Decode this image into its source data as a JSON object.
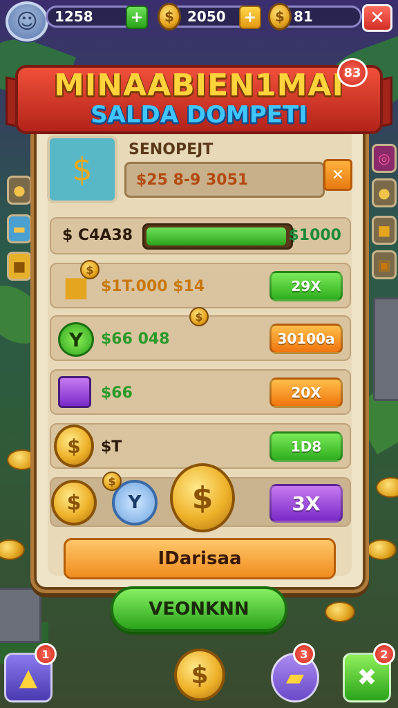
{
  "topbar": {
    "gems_value": "1258",
    "coins_value": "2050",
    "other_value": "81",
    "plus_green": "+",
    "plus_yellow": "+",
    "close": "✕"
  },
  "banner": {
    "title": "MINAABIEN1MAI",
    "subtitle": "SALDA DOMPETI",
    "badge": "83"
  },
  "wallet": {
    "label": "SENOPEJT",
    "value": "$25 8-9 3051",
    "close_label": "✕"
  },
  "progress": {
    "left_label": "$ C4A38",
    "right_label": "$1000",
    "fill_fraction": 0.98
  },
  "items": [
    {
      "text": "$1T.000 $14",
      "text_color": "#c8780a",
      "button_label": "29X",
      "button_style": "green"
    },
    {
      "text": "$66 048",
      "text_color": "#2a9a2a",
      "icon_text": "Y",
      "button_label": "30100a",
      "button_style": "orange"
    },
    {
      "text": "$66",
      "text_color": "#2a9a2a",
      "button_label": "20X",
      "button_style": "orange"
    },
    {
      "text": "$T",
      "text_color": "#2b1a0a",
      "button_label": "1D8",
      "button_style": "green"
    },
    {
      "button_label": "3X",
      "button_style": "purple"
    }
  ],
  "coin_symbol": "$",
  "token_symbol": "Y",
  "action_label": "IDarisaa",
  "confirm_label": "VEONKNN",
  "bottom": {
    "left_badge": "1",
    "mid_badge": "3",
    "right_badge": "2"
  },
  "colors": {
    "panel": "#efe3c8",
    "accent_red": "#d22e24",
    "accent_green": "#2aa31a",
    "accent_orange": "#f0760e",
    "accent_purple": "#7a2ac8",
    "gold": "#e6a51f"
  }
}
